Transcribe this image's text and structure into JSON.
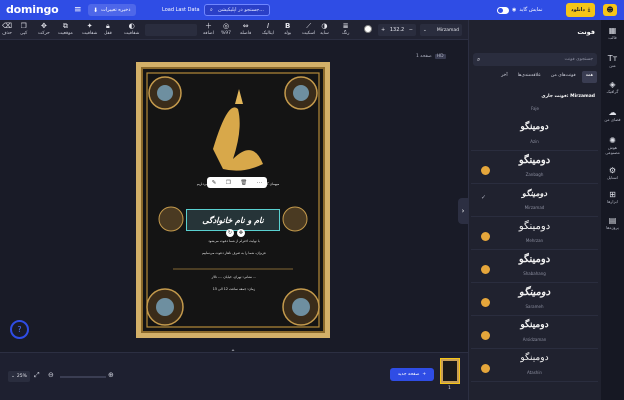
{
  "topbar": {
    "logo": "domingo",
    "undo_label": "ذخیره تغییرات",
    "design_title": "Load Last Data",
    "search_placeholder": "جستجو در اپلیکیشن...",
    "toggle_label": "نمایش گاید",
    "download_label": "دانلود"
  },
  "toolbar": {
    "font_name": "Mirzamad",
    "font_size": "132.2",
    "items": [
      "رنگ",
      "شفافیت",
      "ساید",
      "اسکیت",
      "بولد",
      "ایتالیک",
      "فاصله",
      "%97",
      "اضافه",
      "دبل",
      "موقعیت",
      "شفافیت",
      "قفل",
      "حرکت",
      "کپی",
      "حذف",
      "کپی"
    ],
    "colors": {
      "accent": "#2f4de5",
      "download": "#f5c518",
      "crown": "#e5a63b"
    }
  },
  "canvas": {
    "page_label": "صفحه 1",
    "poster": {
      "text_lines": [
        "میهمان گرامی، حضور شما را در این مراسم گرامی می‌داریم",
        "نام و نام خانوادگی",
        "با نهایت احترام از شما دعوت می‌شود",
        "عزیزان، شما را به صرف ناهار دعوت می‌نماییم",
        "نشانی: تهران، خیابان ...، تالار ...",
        "زمان: جمعه ساعت 12 الی 15"
      ]
    }
  },
  "bottombar": {
    "zoom": "25%",
    "add_page_label": "صفحه جدید",
    "page_number": "1"
  },
  "rightpanel": {
    "title": "فونت",
    "search_placeholder": "جستجوی فونت",
    "tabs": [
      "همه",
      "فونت‌های من",
      "علاقه‌مندی‌ها",
      "آخر"
    ],
    "current_label": "فونت جاری: Mirzamad",
    "current_sub": "Faje",
    "fonts": [
      {
        "sample": "دومینگو",
        "name": "Azin",
        "crown": false
      },
      {
        "sample": "دومینگو",
        "name": "Zanbagh",
        "crown": true
      },
      {
        "sample": "دومینگو",
        "name": "Mirzamad",
        "crown": false,
        "selected": true
      },
      {
        "sample": "دومینگو",
        "name": "Mehrzan",
        "crown": true
      },
      {
        "sample": "دومینگو",
        "name": "Shabahang",
        "crown": true
      },
      {
        "sample": "دومینگو",
        "name": "Sarameh",
        "crown": true
      },
      {
        "sample": "دومینگو",
        "name": "Arsidzaman",
        "crown": true
      },
      {
        "sample": "دومینگو",
        "name": "Atashin",
        "crown": true
      }
    ]
  },
  "sidebar": {
    "items": [
      {
        "label": "قالب",
        "icon": "template-icon"
      },
      {
        "label": "متن",
        "icon": "text-icon"
      },
      {
        "label": "گرافیک",
        "icon": "graphics-icon"
      },
      {
        "label": "فضای من",
        "icon": "cloud-icon"
      },
      {
        "label": "هوش مصنوعی",
        "icon": "ai-icon"
      },
      {
        "label": "استایل",
        "icon": "style-icon"
      },
      {
        "label": "ابزارها",
        "icon": "tools-icon"
      },
      {
        "label": "پروژه‌ها",
        "icon": "projects-icon"
      }
    ]
  }
}
